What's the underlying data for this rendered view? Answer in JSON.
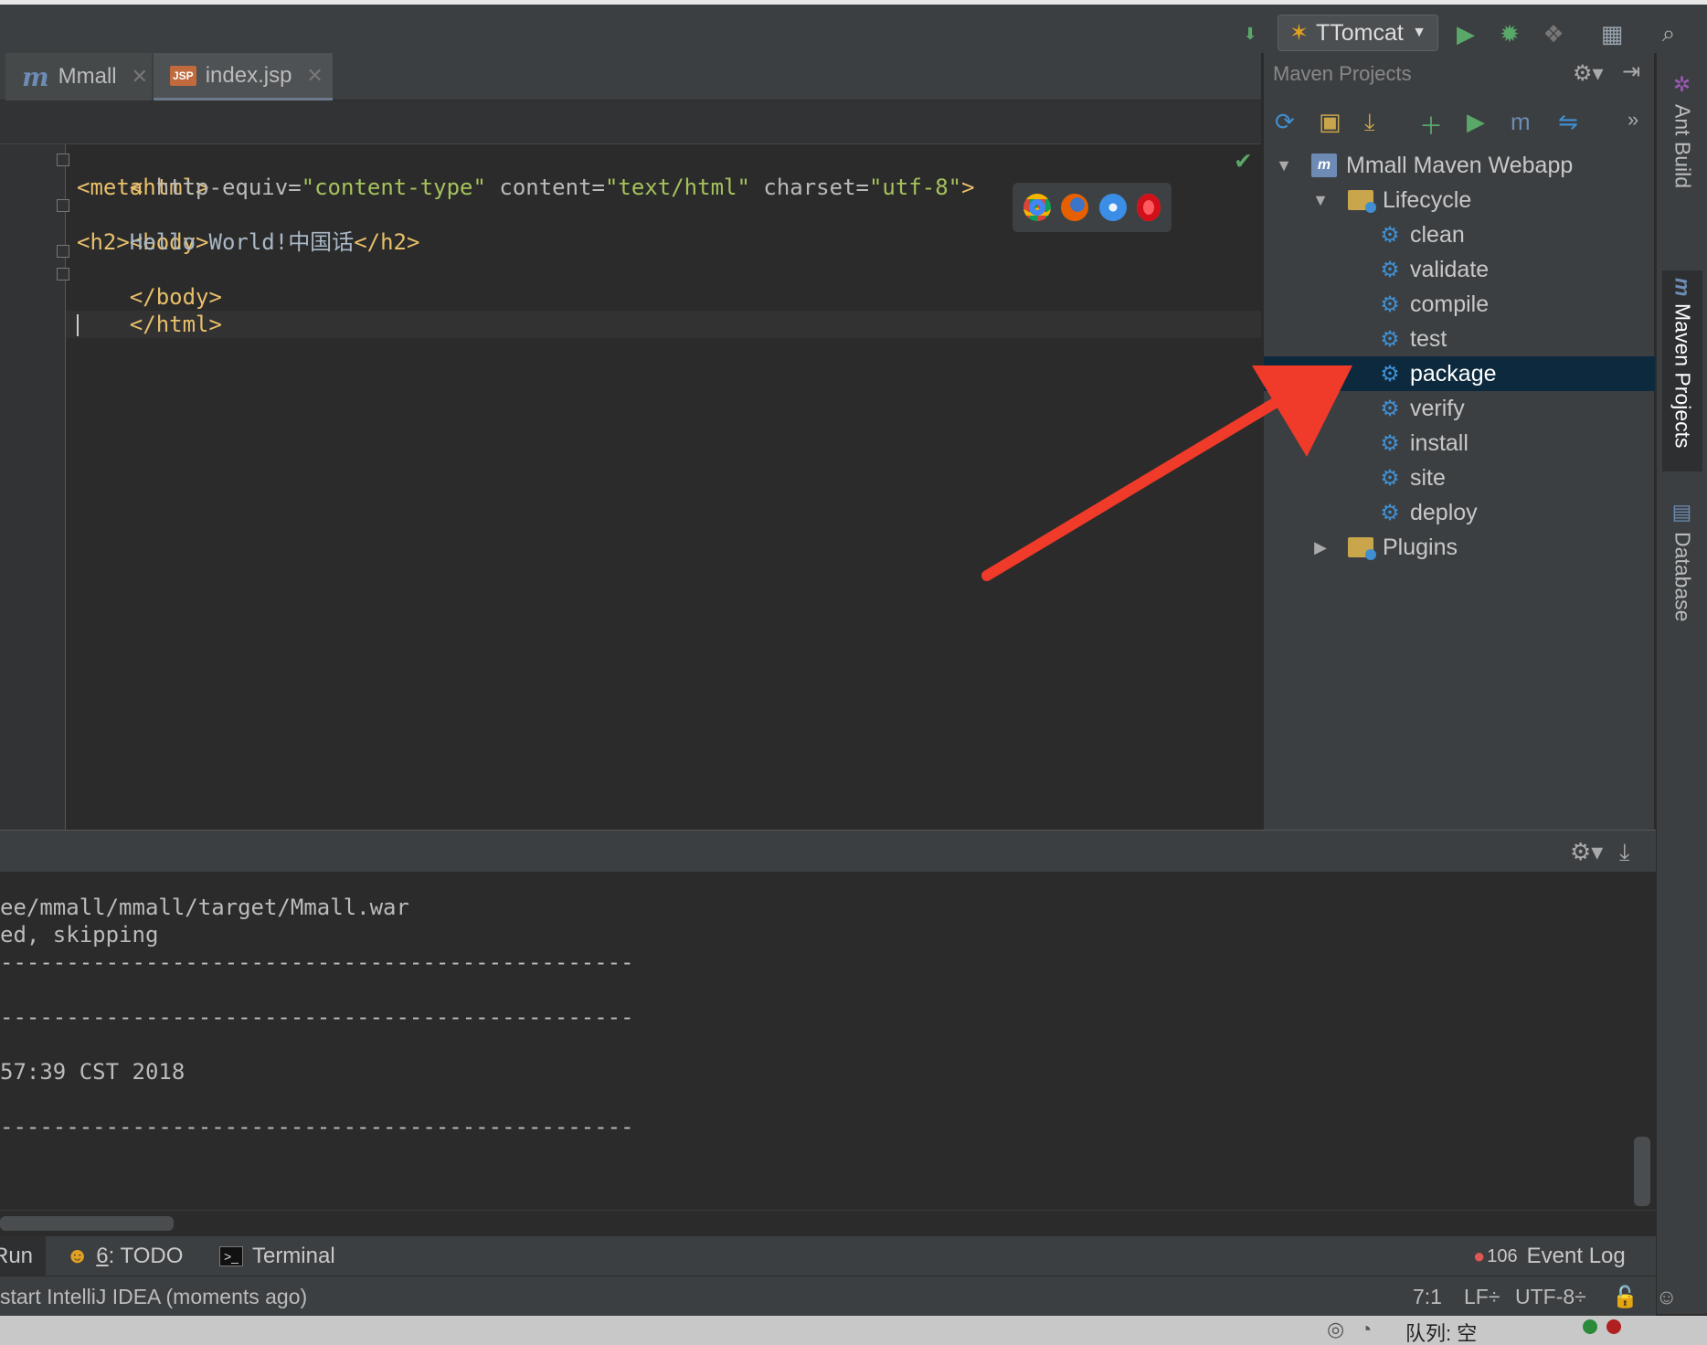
{
  "toolbar": {
    "run_config": "TTomcat",
    "icons": [
      "vcs-update-icon",
      "run-config-icon",
      "run-icon",
      "debug-icon",
      "coverage-icon",
      "project-structure-icon",
      "search-icon"
    ]
  },
  "editor": {
    "tabs": [
      {
        "label": "Mmall",
        "active": false
      },
      {
        "label": "index.jsp",
        "active": true
      }
    ],
    "code": {
      "l1_tag": "<html>",
      "l2_tag_open": "<meta",
      "l2_attr1": " http-equiv=",
      "l2_val1": "\"content-type\"",
      "l2_attr2": " content=",
      "l2_val2": "\"text/html\"",
      "l2_attr3": " charset=",
      "l2_val3": "\"utf-8\"",
      "l2_tag_close": ">",
      "l3_tag": "<body>",
      "l4_open": "<h2>",
      "l4_text": "Hello World!中国话",
      "l4_close": "</h2>",
      "l5_tag": "</body>",
      "l6_tag": "</html>"
    }
  },
  "maven": {
    "title": "Maven Projects",
    "project": "Mmall Maven Webapp",
    "lifecycle_label": "Lifecycle",
    "phases": [
      "clean",
      "validate",
      "compile",
      "test",
      "package",
      "verify",
      "install",
      "site",
      "deploy"
    ],
    "selected_phase": "package",
    "plugins_label": "Plugins"
  },
  "right_stripe": {
    "ant": "Ant Build",
    "maven": "Maven Projects",
    "database": "Database"
  },
  "console": {
    "lines": [
      "ee/mmall/mmall/target/Mmall.war",
      "ed, skipping",
      "------------------------------------------------",
      "",
      "------------------------------------------------",
      "",
      "57:39 CST 2018",
      "",
      "------------------------------------------------"
    ]
  },
  "tool_windows": {
    "run": "Run",
    "todo_num": "6",
    "todo": ": TODO",
    "terminal": "Terminal",
    "event_count": "106",
    "event_log": "Event Log"
  },
  "status": {
    "message": "start IntelliJ IDEA (moments ago)",
    "position": "7:1",
    "line_sep": "LF÷",
    "encoding": "UTF-8÷"
  },
  "system": {
    "queue": "队列: 空"
  },
  "colors": {
    "accent": "#3f8fd2",
    "selection": "#0d293e",
    "annotation_arrow": "#f03a2a",
    "run_green": "#59a869"
  }
}
